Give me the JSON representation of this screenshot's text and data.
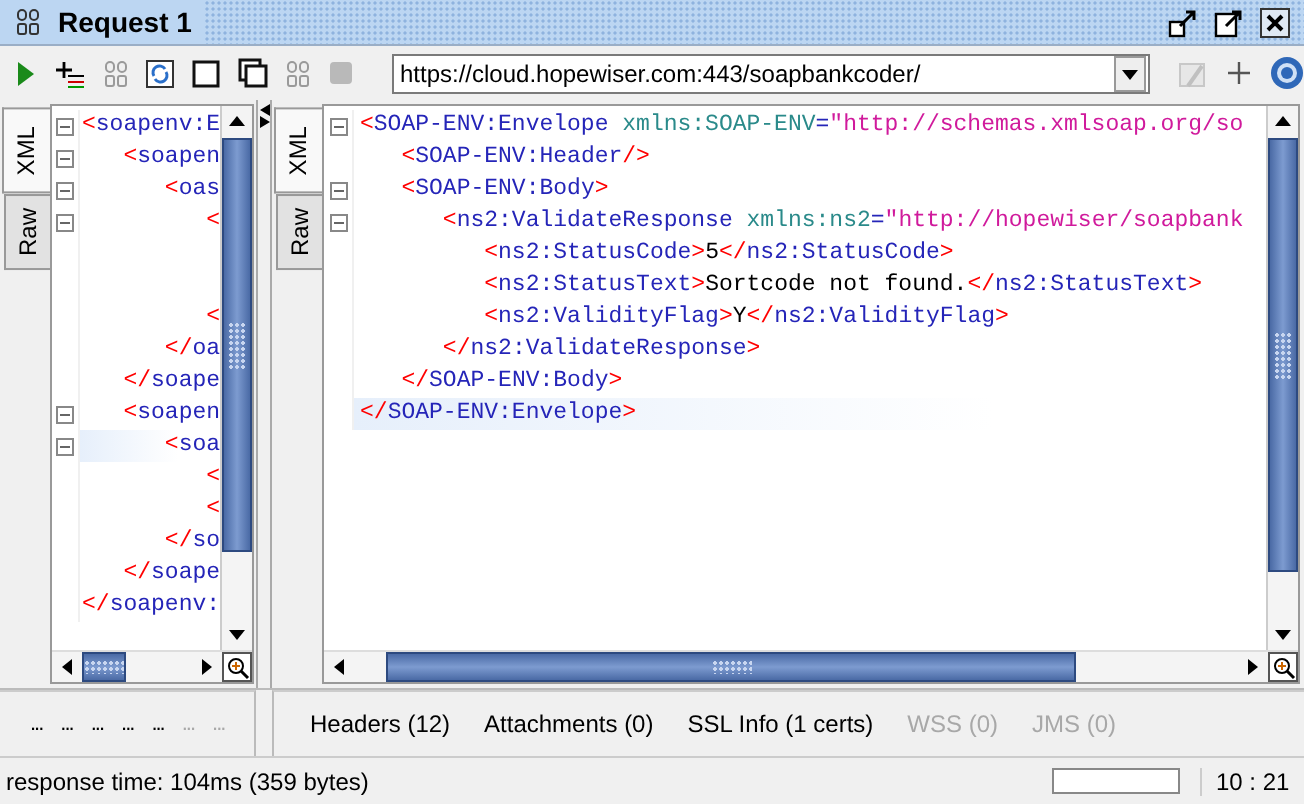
{
  "window": {
    "title": "Request 1"
  },
  "toolbar": [
    {
      "kind": "run",
      "disabled": false
    },
    {
      "kind": "add",
      "disabled": false
    },
    {
      "kind": "logo",
      "disabled": true
    },
    {
      "kind": "refresh",
      "disabled": false
    },
    {
      "kind": "window",
      "disabled": false
    },
    {
      "kind": "windows",
      "disabled": false
    },
    {
      "kind": "logo",
      "disabled": true
    },
    {
      "kind": "stop",
      "disabled": true
    }
  ],
  "endpoint": {
    "value": "https://cloud.hopewiser.com:443/soapbankcoder/"
  },
  "endpoint_tools": [
    {
      "kind": "edit",
      "disabled": true
    },
    {
      "kind": "plus",
      "disabled": false
    },
    {
      "kind": "help",
      "disabled": false
    }
  ],
  "request_pane": {
    "tabs": [
      {
        "label": "XML",
        "selected": true
      },
      {
        "label": "Raw",
        "selected": false
      }
    ],
    "lines": [
      {
        "fold": true,
        "current": false,
        "parts": [
          {
            "kind": "bracket",
            "text": "<"
          },
          {
            "kind": "tag",
            "text": "soapenv:E"
          }
        ]
      },
      {
        "fold": true,
        "current": false,
        "parts": [
          {
            "kind": "bracket",
            "text": "   <"
          },
          {
            "kind": "tag",
            "text": "soapen"
          }
        ]
      },
      {
        "fold": true,
        "current": false,
        "parts": [
          {
            "kind": "bracket",
            "text": "      <"
          },
          {
            "kind": "tag",
            "text": "oas"
          }
        ]
      },
      {
        "fold": true,
        "current": false,
        "parts": [
          {
            "kind": "bracket",
            "text": "         <"
          }
        ]
      },
      {
        "fold": false,
        "current": false
      },
      {
        "fold": false,
        "current": false
      },
      {
        "fold": false,
        "current": false,
        "parts": [
          {
            "kind": "bracket",
            "text": "         <"
          }
        ]
      },
      {
        "fold": false,
        "current": false,
        "parts": [
          {
            "kind": "bracket",
            "text": "      </"
          },
          {
            "kind": "tag",
            "text": "oa"
          }
        ]
      },
      {
        "fold": false,
        "current": false,
        "parts": [
          {
            "kind": "bracket",
            "text": "   </"
          },
          {
            "kind": "tag",
            "text": "soape"
          }
        ]
      },
      {
        "fold": true,
        "current": false,
        "parts": [
          {
            "kind": "bracket",
            "text": "   <"
          },
          {
            "kind": "tag",
            "text": "soapen"
          }
        ]
      },
      {
        "fold": true,
        "current": true,
        "parts": [
          {
            "kind": "bracket",
            "text": "      <"
          },
          {
            "kind": "tag",
            "text": "soa"
          }
        ]
      },
      {
        "fold": false,
        "current": false,
        "parts": [
          {
            "kind": "bracket",
            "text": "         <"
          }
        ]
      },
      {
        "fold": false,
        "current": false,
        "parts": [
          {
            "kind": "bracket",
            "text": "         <"
          }
        ]
      },
      {
        "fold": false,
        "current": false,
        "parts": [
          {
            "kind": "bracket",
            "text": "      </"
          },
          {
            "kind": "tag",
            "text": "so"
          }
        ]
      },
      {
        "fold": false,
        "current": false,
        "parts": [
          {
            "kind": "bracket",
            "text": "   </"
          },
          {
            "kind": "tag",
            "text": "soape"
          }
        ]
      },
      {
        "fold": false,
        "current": false,
        "parts": [
          {
            "kind": "bracket",
            "text": "</"
          },
          {
            "kind": "tag",
            "text": "soapenv:"
          }
        ]
      }
    ]
  },
  "response_pane": {
    "tabs": [
      {
        "label": "XML",
        "selected": true
      },
      {
        "label": "Raw",
        "selected": false
      }
    ],
    "lines": [
      {
        "fold": true,
        "current": false,
        "parts": [
          {
            "kind": "bracket",
            "text": "<"
          },
          {
            "kind": "tag",
            "text": "SOAP-ENV:Envelope "
          },
          {
            "kind": "attribute",
            "text": "xmlns:SOAP-ENV"
          },
          {
            "kind": "equals",
            "text": "="
          },
          {
            "kind": "value",
            "text": "\"http://schemas.xmlsoap.org/so"
          }
        ]
      },
      {
        "fold": false,
        "current": false,
        "parts": [
          {
            "kind": "bracket",
            "text": "   <"
          },
          {
            "kind": "tag",
            "text": "SOAP-ENV:Header"
          },
          {
            "kind": "bracket",
            "text": "/>"
          }
        ]
      },
      {
        "fold": true,
        "current": false,
        "parts": [
          {
            "kind": "bracket",
            "text": "   <"
          },
          {
            "kind": "tag",
            "text": "SOAP-ENV:Body"
          },
          {
            "kind": "bracket",
            "text": ">"
          }
        ]
      },
      {
        "fold": true,
        "current": false,
        "parts": [
          {
            "kind": "bracket",
            "text": "      <"
          },
          {
            "kind": "tag",
            "text": "ns2:ValidateResponse "
          },
          {
            "kind": "attribute",
            "text": "xmlns:ns2"
          },
          {
            "kind": "equals",
            "text": "="
          },
          {
            "kind": "value",
            "text": "\"http://hopewiser/soapbank"
          }
        ]
      },
      {
        "fold": false,
        "current": false,
        "parts": [
          {
            "kind": "bracket",
            "text": "         <"
          },
          {
            "kind": "tag",
            "text": "ns2:StatusCode"
          },
          {
            "kind": "bracket",
            "text": ">"
          },
          {
            "kind": "text",
            "text": "5"
          },
          {
            "kind": "bracket",
            "text": "</"
          },
          {
            "kind": "tag",
            "text": "ns2:StatusCode"
          },
          {
            "kind": "bracket",
            "text": ">"
          }
        ]
      },
      {
        "fold": false,
        "current": false,
        "parts": [
          {
            "kind": "bracket",
            "text": "         <"
          },
          {
            "kind": "tag",
            "text": "ns2:StatusText"
          },
          {
            "kind": "bracket",
            "text": ">"
          },
          {
            "kind": "text",
            "text": "Sortcode not found."
          },
          {
            "kind": "bracket",
            "text": "</"
          },
          {
            "kind": "tag",
            "text": "ns2:StatusText"
          },
          {
            "kind": "bracket",
            "text": ">"
          }
        ]
      },
      {
        "fold": false,
        "current": false,
        "parts": [
          {
            "kind": "bracket",
            "text": "         <"
          },
          {
            "kind": "tag",
            "text": "ns2:ValidityFlag"
          },
          {
            "kind": "bracket",
            "text": ">"
          },
          {
            "kind": "text",
            "text": "Y"
          },
          {
            "kind": "bracket",
            "text": "</"
          },
          {
            "kind": "tag",
            "text": "ns2:ValidityFlag"
          },
          {
            "kind": "bracket",
            "text": ">"
          }
        ]
      },
      {
        "fold": false,
        "current": false,
        "parts": [
          {
            "kind": "bracket",
            "text": "      </"
          },
          {
            "kind": "tag",
            "text": "ns2:ValidateResponse"
          },
          {
            "kind": "bracket",
            "text": ">"
          }
        ]
      },
      {
        "fold": false,
        "current": false,
        "parts": [
          {
            "kind": "bracket",
            "text": "   </"
          },
          {
            "kind": "tag",
            "text": "SOAP-ENV:Body"
          },
          {
            "kind": "bracket",
            "text": ">"
          }
        ]
      },
      {
        "fold": false,
        "current": true,
        "parts": [
          {
            "kind": "bracket",
            "text": "</"
          },
          {
            "kind": "tag",
            "text": "SOAP-ENV:Envelope"
          },
          {
            "kind": "bracket",
            "text": ">"
          }
        ]
      }
    ]
  },
  "request_tabs": [
    {
      "label": "...",
      "disabled": false
    },
    {
      "label": "...",
      "disabled": false
    },
    {
      "label": "...",
      "disabled": false
    },
    {
      "label": "...",
      "disabled": false
    },
    {
      "label": "...",
      "disabled": false
    },
    {
      "label": "...",
      "disabled": true
    },
    {
      "label": "...",
      "disabled": true
    }
  ],
  "response_tabs": [
    {
      "label": "Headers (12)",
      "disabled": false
    },
    {
      "label": "Attachments (0)",
      "disabled": false
    },
    {
      "label": "SSL Info (1 certs)",
      "disabled": false
    },
    {
      "label": "WSS (0)",
      "disabled": true
    },
    {
      "label": "JMS (0)",
      "disabled": true
    }
  ],
  "status_bar": {
    "text": "response time: 104ms (359 bytes)",
    "position": "10 : 21"
  }
}
